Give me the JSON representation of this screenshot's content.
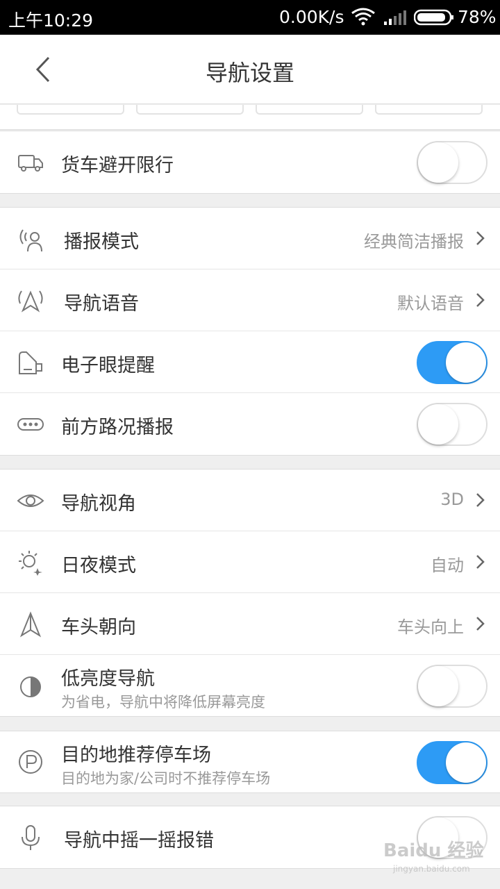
{
  "status_bar": {
    "time": "上午10:29",
    "net_speed": "0.00K/s",
    "battery": "78%"
  },
  "header": {
    "title": "导航设置",
    "back_icon": "chevron-left-icon"
  },
  "colors": {
    "accent": "#2d9bf5",
    "value_text": "#999999",
    "background": "#efefef"
  },
  "groups": {
    "truck": {
      "label": "货车避开限行",
      "toggle": false,
      "icon": "truck-icon"
    },
    "voice": {
      "broadcast_mode": {
        "label": "播报模式",
        "value": "经典简洁播报",
        "icon": "speaker-person-icon"
      },
      "nav_voice": {
        "label": "导航语音",
        "value": "默认语音",
        "icon": "nav-voice-icon"
      },
      "camera_alert": {
        "label": "电子眼提醒",
        "toggle": true,
        "icon": "camera-icon"
      },
      "traffic_ahead": {
        "label": "前方路况播报",
        "toggle": false,
        "icon": "dots-icon"
      }
    },
    "display": {
      "view_angle": {
        "label": "导航视角",
        "value": "3D",
        "icon": "eye-icon"
      },
      "day_night": {
        "label": "日夜模式",
        "value": "自动",
        "icon": "sun-moon-icon"
      },
      "heading": {
        "label": "车头朝向",
        "value": "车头向上",
        "icon": "arrow-icon"
      },
      "low_brightness": {
        "label": "低亮度导航",
        "sub": "为省电，导航中将降低屏幕亮度",
        "toggle": false,
        "icon": "contrast-icon"
      }
    },
    "parking": {
      "label": "目的地推荐停车场",
      "sub": "目的地为家/公司时不推荐停车场",
      "toggle": true,
      "icon": "parking-icon"
    },
    "shake": {
      "label": "导航中摇一摇报错",
      "toggle": false,
      "icon": "microphone-icon"
    }
  },
  "watermark": {
    "text": "Baidu 经验",
    "url": "jingyan.baidu.com"
  }
}
